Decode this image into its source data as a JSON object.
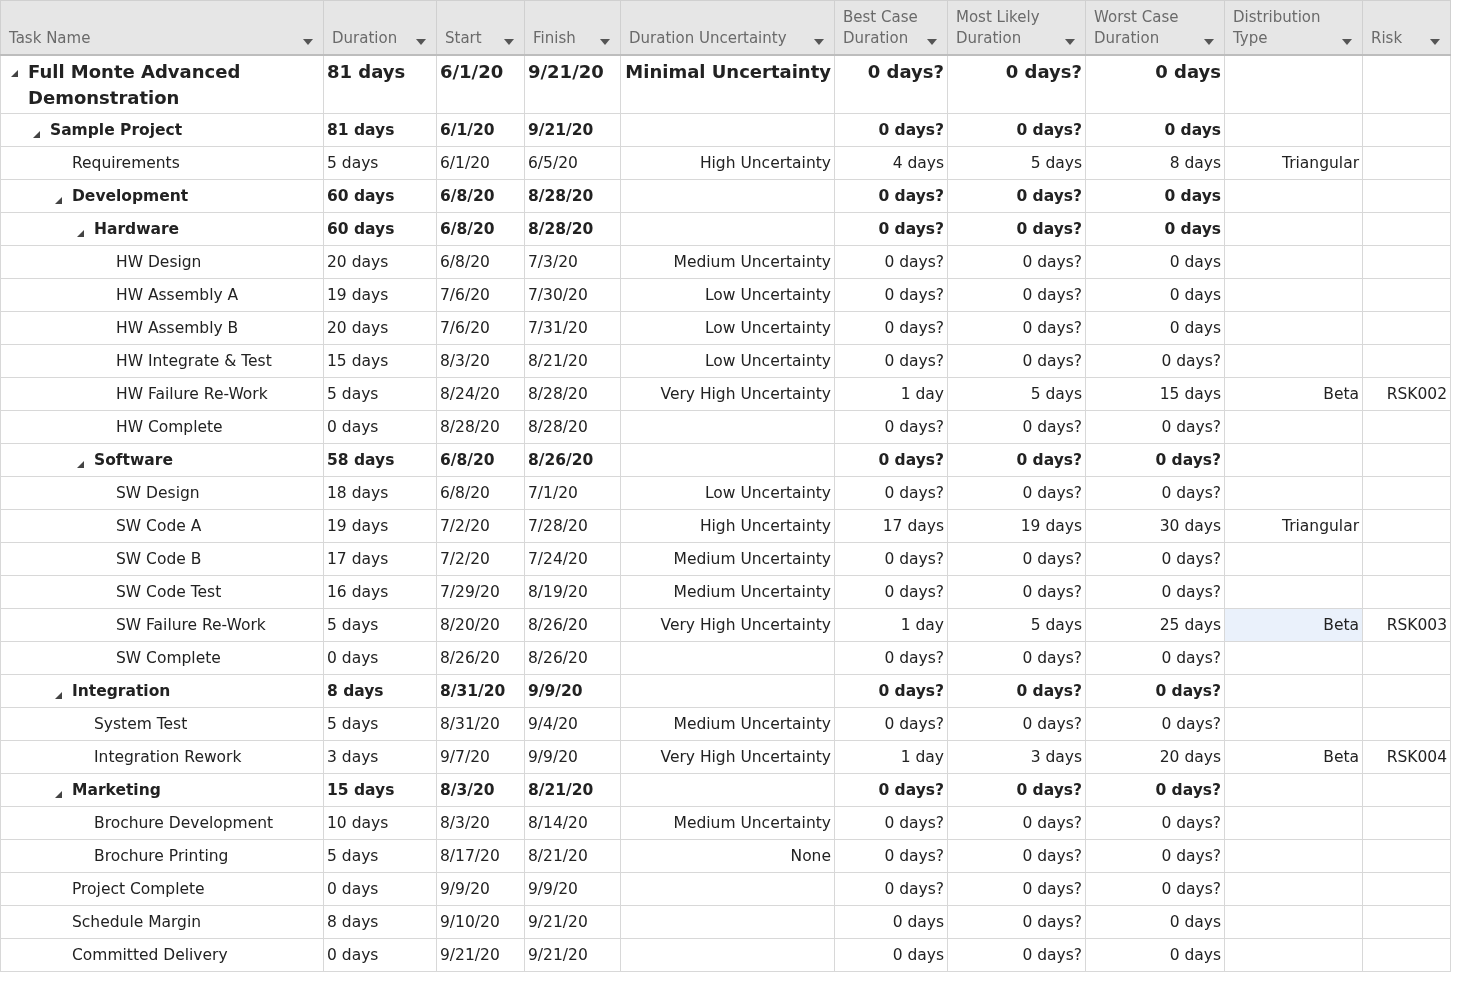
{
  "columns": [
    {
      "label": "Task Name"
    },
    {
      "label": "Duration"
    },
    {
      "label": "Start"
    },
    {
      "label": "Finish"
    },
    {
      "label": "Duration Uncertainty"
    },
    {
      "label": "Best Case Duration"
    },
    {
      "label": "Most Likely Duration"
    },
    {
      "label": "Worst Case Duration"
    },
    {
      "label": "Distribution Type"
    },
    {
      "label": "Risk"
    }
  ],
  "tasks": [
    {
      "kind": "project",
      "expanded": true,
      "dist_selected": false,
      "cells": [
        "Full Monte Advanced Demonstration",
        "81 days",
        "6/1/20",
        "9/21/20",
        "Minimal Uncertainty",
        "0 days?",
        "0 days?",
        "0 days"
      ],
      "children": [
        {
          "kind": "summary",
          "expanded": true,
          "dist_selected": false,
          "cells": [
            "Sample Project",
            "81 days",
            "6/1/20",
            "9/21/20",
            "",
            "0 days?",
            "0 days?",
            "0 days"
          ],
          "children": [
            {
              "kind": "task",
              "dist_selected": false,
              "cells": [
                "Requirements",
                "5 days",
                "6/1/20",
                "6/5/20",
                "High Uncertainty",
                "4 days",
                "5 days",
                "8 days",
                "Triangular"
              ]
            },
            {
              "kind": "summary",
              "expanded": true,
              "dist_selected": false,
              "cells": [
                "Development",
                "60 days",
                "6/8/20",
                "8/28/20",
                "",
                "0 days?",
                "0 days?",
                "0 days"
              ],
              "children": [
                {
                  "kind": "summary",
                  "expanded": true,
                  "dist_selected": false,
                  "cells": [
                    "Hardware",
                    "60 days",
                    "6/8/20",
                    "8/28/20",
                    "",
                    "0 days?",
                    "0 days?",
                    "0 days"
                  ],
                  "children": [
                    {
                      "kind": "task",
                      "dist_selected": false,
                      "cells": [
                        "HW Design",
                        "20 days",
                        "6/8/20",
                        "7/3/20",
                        "Medium Uncertainty",
                        "0 days?",
                        "0 days?",
                        "0 days"
                      ]
                    },
                    {
                      "kind": "task",
                      "dist_selected": false,
                      "cells": [
                        "HW Assembly A",
                        "19 days",
                        "7/6/20",
                        "7/30/20",
                        "Low Uncertainty",
                        "0 days?",
                        "0 days?",
                        "0 days"
                      ]
                    },
                    {
                      "kind": "task",
                      "dist_selected": false,
                      "cells": [
                        "HW Assembly B",
                        "20 days",
                        "7/6/20",
                        "7/31/20",
                        "Low Uncertainty",
                        "0 days?",
                        "0 days?",
                        "0 days"
                      ]
                    },
                    {
                      "kind": "task",
                      "dist_selected": false,
                      "cells": [
                        "HW Integrate & Test",
                        "15 days",
                        "8/3/20",
                        "8/21/20",
                        "Low Uncertainty",
                        "0 days?",
                        "0 days?",
                        "0 days?"
                      ]
                    },
                    {
                      "kind": "task",
                      "dist_selected": false,
                      "cells": [
                        "HW Failure Re-Work",
                        "5 days",
                        "8/24/20",
                        "8/28/20",
                        "Very High Uncertainty",
                        "1 day",
                        "5 days",
                        "15 days",
                        "Beta",
                        "RSK002"
                      ]
                    },
                    {
                      "kind": "task",
                      "dist_selected": false,
                      "cells": [
                        "HW Complete",
                        "0 days",
                        "8/28/20",
                        "8/28/20",
                        "",
                        "0 days?",
                        "0 days?",
                        "0 days?"
                      ]
                    }
                  ]
                },
                {
                  "kind": "summary",
                  "expanded": true,
                  "dist_selected": false,
                  "cells": [
                    "Software",
                    "58 days",
                    "6/8/20",
                    "8/26/20",
                    "",
                    "0 days?",
                    "0 days?",
                    "0 days?"
                  ],
                  "children": [
                    {
                      "kind": "task",
                      "dist_selected": false,
                      "cells": [
                        "SW Design",
                        "18 days",
                        "6/8/20",
                        "7/1/20",
                        "Low Uncertainty",
                        "0 days?",
                        "0 days?",
                        "0 days?"
                      ]
                    },
                    {
                      "kind": "task",
                      "dist_selected": false,
                      "cells": [
                        "SW Code A",
                        "19 days",
                        "7/2/20",
                        "7/28/20",
                        "High Uncertainty",
                        "17 days",
                        "19 days",
                        "30 days",
                        "Triangular"
                      ]
                    },
                    {
                      "kind": "task",
                      "dist_selected": false,
                      "cells": [
                        "SW Code B",
                        "17 days",
                        "7/2/20",
                        "7/24/20",
                        "Medium Uncertainty",
                        "0 days?",
                        "0 days?",
                        "0 days?"
                      ]
                    },
                    {
                      "kind": "task",
                      "dist_selected": false,
                      "cells": [
                        "SW Code Test",
                        "16 days",
                        "7/29/20",
                        "8/19/20",
                        "Medium Uncertainty",
                        "0 days?",
                        "0 days?",
                        "0 days?"
                      ]
                    },
                    {
                      "kind": "task",
                      "dist_selected": true,
                      "cells": [
                        "SW Failure Re-Work",
                        "5 days",
                        "8/20/20",
                        "8/26/20",
                        "Very High Uncertainty",
                        "1 day",
                        "5 days",
                        "25 days",
                        "Beta",
                        "RSK003"
                      ]
                    },
                    {
                      "kind": "task",
                      "dist_selected": false,
                      "cells": [
                        "SW Complete",
                        "0 days",
                        "8/26/20",
                        "8/26/20",
                        "",
                        "0 days?",
                        "0 days?",
                        "0 days?"
                      ]
                    }
                  ]
                }
              ]
            },
            {
              "kind": "summary",
              "expanded": true,
              "dist_selected": false,
              "cells": [
                "Integration",
                "8 days",
                "8/31/20",
                "9/9/20",
                "",
                "0 days?",
                "0 days?",
                "0 days?"
              ],
              "children": [
                {
                  "kind": "task",
                  "dist_selected": false,
                  "cells": [
                    "System Test",
                    "5 days",
                    "8/31/20",
                    "9/4/20",
                    "Medium Uncertainty",
                    "0 days?",
                    "0 days?",
                    "0 days?"
                  ]
                },
                {
                  "kind": "task",
                  "dist_selected": false,
                  "cells": [
                    "Integration Rework",
                    "3 days",
                    "9/7/20",
                    "9/9/20",
                    "Very High Uncertainty",
                    "1 day",
                    "3 days",
                    "20 days",
                    "Beta",
                    "RSK004"
                  ]
                }
              ]
            },
            {
              "kind": "summary",
              "expanded": true,
              "dist_selected": false,
              "cells": [
                "Marketing",
                "15 days",
                "8/3/20",
                "8/21/20",
                "",
                "0 days?",
                "0 days?",
                "0 days?"
              ],
              "children": [
                {
                  "kind": "task",
                  "dist_selected": false,
                  "cells": [
                    "Brochure Development",
                    "10 days",
                    "8/3/20",
                    "8/14/20",
                    "Medium Uncertainty",
                    "0 days?",
                    "0 days?",
                    "0 days?"
                  ]
                },
                {
                  "kind": "task",
                  "dist_selected": false,
                  "cells": [
                    "Brochure Printing",
                    "5 days",
                    "8/17/20",
                    "8/21/20",
                    "None",
                    "0 days?",
                    "0 days?",
                    "0 days?"
                  ]
                }
              ]
            },
            {
              "kind": "task",
              "dist_selected": false,
              "cells": [
                "Project Complete",
                "0 days",
                "9/9/20",
                "9/9/20",
                "",
                "0 days?",
                "0 days?",
                "0 days?"
              ]
            },
            {
              "kind": "task",
              "dist_selected": false,
              "cells": [
                "Schedule Margin",
                "8 days",
                "9/10/20",
                "9/21/20",
                "",
                "0 days",
                "0 days?",
                "0 days"
              ]
            },
            {
              "kind": "task",
              "dist_selected": false,
              "cells": [
                "Committed Delivery",
                "0 days",
                "9/21/20",
                "9/21/20",
                "",
                "0 days",
                "0 days?",
                "0 days"
              ]
            }
          ]
        }
      ]
    }
  ]
}
